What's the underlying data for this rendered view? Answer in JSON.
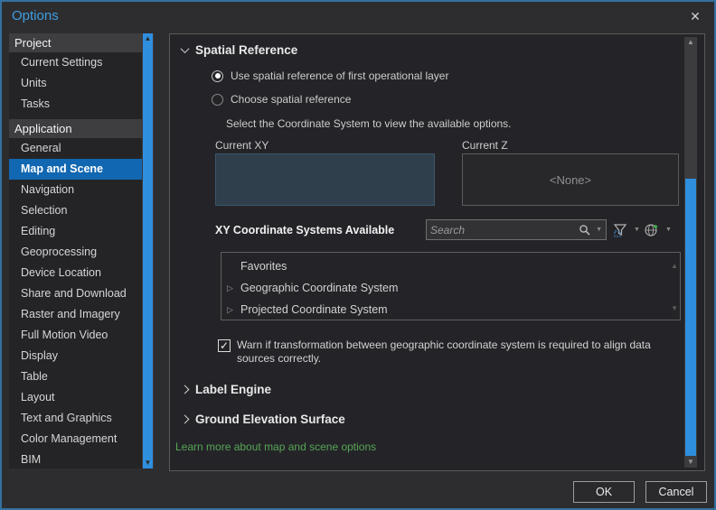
{
  "window": {
    "title": "Options",
    "close_icon": "✕"
  },
  "sidebar": {
    "sections": [
      {
        "header": "Project",
        "items": [
          {
            "label": "Current Settings"
          },
          {
            "label": "Units"
          },
          {
            "label": "Tasks"
          }
        ]
      },
      {
        "header": "Application",
        "items": [
          {
            "label": "General"
          },
          {
            "label": "Map and Scene",
            "selected": true
          },
          {
            "label": "Navigation"
          },
          {
            "label": "Selection"
          },
          {
            "label": "Editing"
          },
          {
            "label": "Geoprocessing"
          },
          {
            "label": "Device Location"
          },
          {
            "label": "Share and Download"
          },
          {
            "label": "Raster and Imagery"
          },
          {
            "label": "Full Motion Video"
          },
          {
            "label": "Display"
          },
          {
            "label": "Table"
          },
          {
            "label": "Layout"
          },
          {
            "label": "Text and Graphics"
          },
          {
            "label": "Color Management"
          },
          {
            "label": "BIM"
          }
        ]
      }
    ]
  },
  "main": {
    "spatial_reference": {
      "title": "Spatial Reference",
      "radio_first_layer": "Use spatial reference of first operational layer",
      "radio_choose": "Choose spatial reference",
      "select_hint": "Select the Coordinate System to view the available options.",
      "current_xy_label": "Current XY",
      "current_z_label": "Current Z",
      "current_z_value": "<None>",
      "xy_available_label": "XY Coordinate Systems Available",
      "search_placeholder": "Search",
      "tree_items": [
        {
          "label": "Favorites",
          "expandable": false
        },
        {
          "label": "Geographic Coordinate System",
          "expandable": true
        },
        {
          "label": "Projected Coordinate System",
          "expandable": true
        }
      ],
      "warn_checkbox_checked": true,
      "warn_checkbox_label": "Warn if transformation between geographic coordinate system is required to align data sources correctly.",
      "check_glyph": "✓"
    },
    "collapsed_sections": [
      {
        "title": "Label Engine"
      },
      {
        "title": "Ground Elevation Surface"
      }
    ],
    "learn_more": "Learn more about map and scene options"
  },
  "footer": {
    "ok": "OK",
    "cancel": "Cancel"
  },
  "glyphs": {
    "up_arrow": "▲",
    "down_arrow": "▼",
    "caret": "▼",
    "tree_expander": "▷"
  },
  "colors": {
    "dialog_border_blue": "#33719f",
    "title_blue": "#3f9ee0",
    "selection_blue": "#1167b1",
    "scrollbar_blue": "#2f8fdf",
    "current_xy_fill": "#2f404c",
    "link_green": "#57a656",
    "globe_plus_green": "#3fae4a"
  }
}
